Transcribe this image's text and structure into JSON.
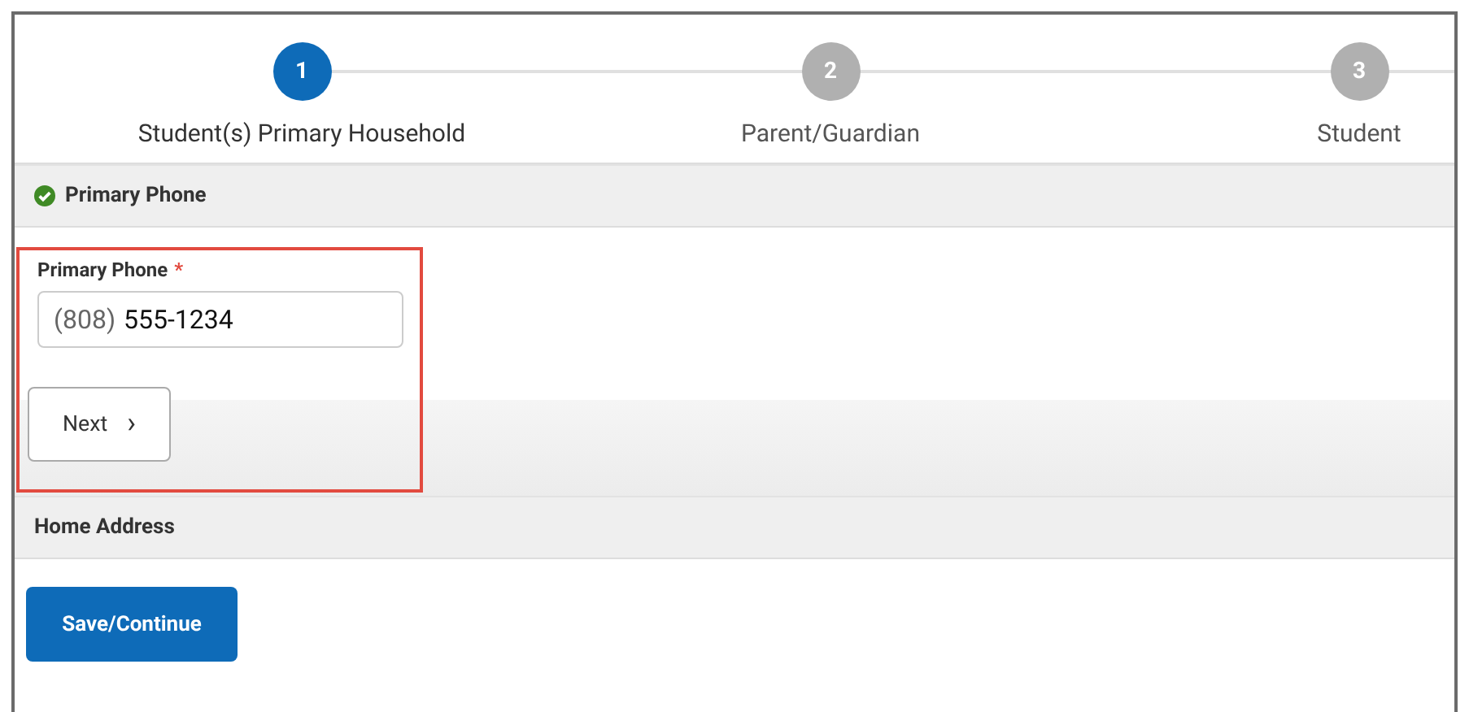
{
  "steps": [
    {
      "number": "1",
      "label": "Student(s) Primary Household",
      "selected": true
    },
    {
      "number": "2",
      "label": "Parent/Guardian",
      "selected": false
    },
    {
      "number": "3",
      "label": "Student",
      "selected": false
    }
  ],
  "sections": [
    {
      "kind": "phone",
      "title": "Primary Phone",
      "complete": true,
      "field": {
        "label": "Primary Phone",
        "required": true,
        "required_mark": "*",
        "area_code": "(808)",
        "number": "555-1234"
      },
      "button": {
        "label": "Next",
        "icon": "›"
      },
      "highlighted": true
    },
    {
      "kind": "plain",
      "title": "Home Address",
      "complete": false
    }
  ],
  "primary_button": "Save/Continue"
}
